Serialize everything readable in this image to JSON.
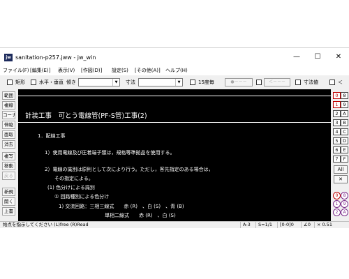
{
  "window": {
    "app_icon": "jw",
    "title": "sanitation-p257.jww - jw_win",
    "minimize": "—",
    "maximize": "☐",
    "close": "✕"
  },
  "menu": [
    "ファイル(F)",
    "[編集(E)]",
    "表示(V)",
    "[作図(D)]",
    "設定(S)",
    "[その他(A)]",
    "ヘルプ(H)"
  ],
  "toolbar": {
    "rect_label": "矩形",
    "hv_label": "水平・垂直",
    "slope_label": "傾き",
    "slope_value": "",
    "dimension_label": "寸法",
    "dimension_value": "",
    "angle15_label": "15度毎",
    "dots_button": "●－－－",
    "arrow_button": "＜－－－",
    "dimval_label": "寸法値",
    "lt_label": "＜"
  },
  "left_tools": [
    "範囲",
    "複線",
    "コーナー",
    "伸縮",
    "面取",
    "消去",
    "複写",
    "移動",
    "戻る",
    "新規",
    "開く",
    "上書"
  ],
  "canvas": {
    "heading": "計装工事　可とう電線管(PF-S管)工事(2)",
    "lines": [
      "1．配線工事",
      "1）使用電線及び圧着端子類は，規格等準拠品を使用する。",
      "2）電線の識別は原則として次により行う。ただし，客先指定のある場合は，",
      "その指定による。",
      "(1) 色分けによる識別",
      "① 回路種別による色分け",
      "1) 交流回路：三相三線式　　赤 (R)　、白 (S)　、青 (B)",
      "単相二線式　　赤 (R)　、白 (S)"
    ]
  },
  "layers": {
    "left": [
      "0",
      "1",
      "2",
      "3",
      "4",
      "5",
      "6",
      "7"
    ],
    "right": [
      "8",
      "9",
      "A",
      "B",
      "C",
      "D",
      "E",
      "F"
    ],
    "all_label": "All",
    "cross_label": "✕",
    "groups": [
      "0",
      "1",
      "2",
      "8",
      "9",
      "A"
    ]
  },
  "status": {
    "message": "始点を指示してください (L)free (R)Read",
    "paper": "A-3",
    "scale": "S=1/1",
    "layer": "[0-0]0",
    "angle": "∠0",
    "zoom": "× 0.51"
  }
}
